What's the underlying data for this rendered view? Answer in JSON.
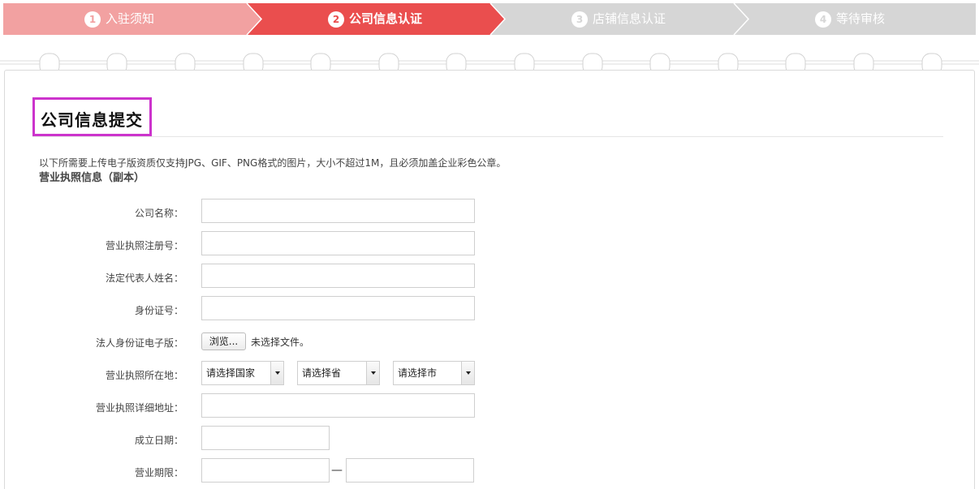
{
  "steps": [
    {
      "num": "1",
      "label": "入驻须知",
      "color": "#f2a1a1"
    },
    {
      "num": "2",
      "label": "公司信息认证",
      "color": "#ea4e4e"
    },
    {
      "num": "3",
      "label": "店铺信息认证",
      "color": "#d6d6d6"
    },
    {
      "num": "4",
      "label": "等待审核",
      "color": "#d6d6d6"
    }
  ],
  "section": {
    "title": "公司信息提交",
    "note": "以下所需要上传电子版资质仅支持JPG、GIF、PNG格式的图片，大小不超过1M，且必须加盖企业彩色公章。",
    "subtitle": "营业执照信息（副本）"
  },
  "form": {
    "company_name_label": "公司名称：",
    "license_no_label": "营业执照注册号：",
    "legal_rep_label": "法定代表人姓名：",
    "id_no_label": "身份证号：",
    "id_file_label": "法人身份证电子版：",
    "browse_label": "浏览...",
    "file_status": "未选择文件。",
    "location_label": "营业执照所在地：",
    "country_select": "请选择国家",
    "province_select": "请选择省",
    "city_select": "请选择市",
    "address_label": "营业执照详细地址：",
    "founded_label": "成立日期：",
    "term_label": "营业期限：",
    "term_separator": "—"
  }
}
